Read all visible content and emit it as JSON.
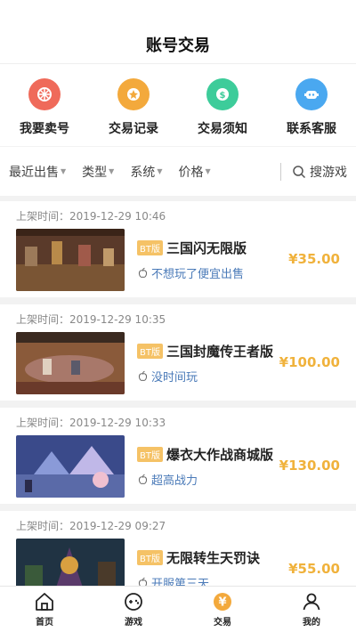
{
  "header": {
    "title": "账号交易"
  },
  "quick_actions": [
    {
      "label": "我要卖号",
      "icon": "sell-icon",
      "color": "#ef6a5a"
    },
    {
      "label": "交易记录",
      "icon": "record-icon",
      "color": "#f3a93c"
    },
    {
      "label": "交易须知",
      "icon": "notice-icon",
      "color": "#3dcc9a"
    },
    {
      "label": "联系客服",
      "icon": "service-icon",
      "color": "#4aa8f0"
    }
  ],
  "filters": {
    "items": [
      "最近出售",
      "类型",
      "系统",
      "价格"
    ],
    "search_label": "搜游戏"
  },
  "listings": [
    {
      "time": "上架时间：2019-12-29 10:46",
      "badge": "BT版",
      "name": "三国闪无限版",
      "desc": "不想玩了便宜出售",
      "price": "¥35.00"
    },
    {
      "time": "上架时间：2019-12-29 10:35",
      "badge": "BT版",
      "name": "三国封魔传王者版",
      "desc": "没时间玩",
      "price": "¥100.00"
    },
    {
      "time": "上架时间：2019-12-29 10:33",
      "badge": "BT版",
      "name": "爆衣大作战商城版",
      "desc": "超高战力",
      "price": "¥130.00"
    },
    {
      "time": "上架时间：2019-12-29 09:27",
      "badge": "BT版",
      "name": "无限转生天罚诀",
      "desc": "开服第三天",
      "price": "¥55.00"
    }
  ],
  "tabbar": [
    {
      "label": "首页",
      "icon": "home-icon"
    },
    {
      "label": "游戏",
      "icon": "gamepad-icon"
    },
    {
      "label": "交易",
      "icon": "trade-icon",
      "active_color": "#f3a93c"
    },
    {
      "label": "我的",
      "icon": "user-icon"
    }
  ]
}
